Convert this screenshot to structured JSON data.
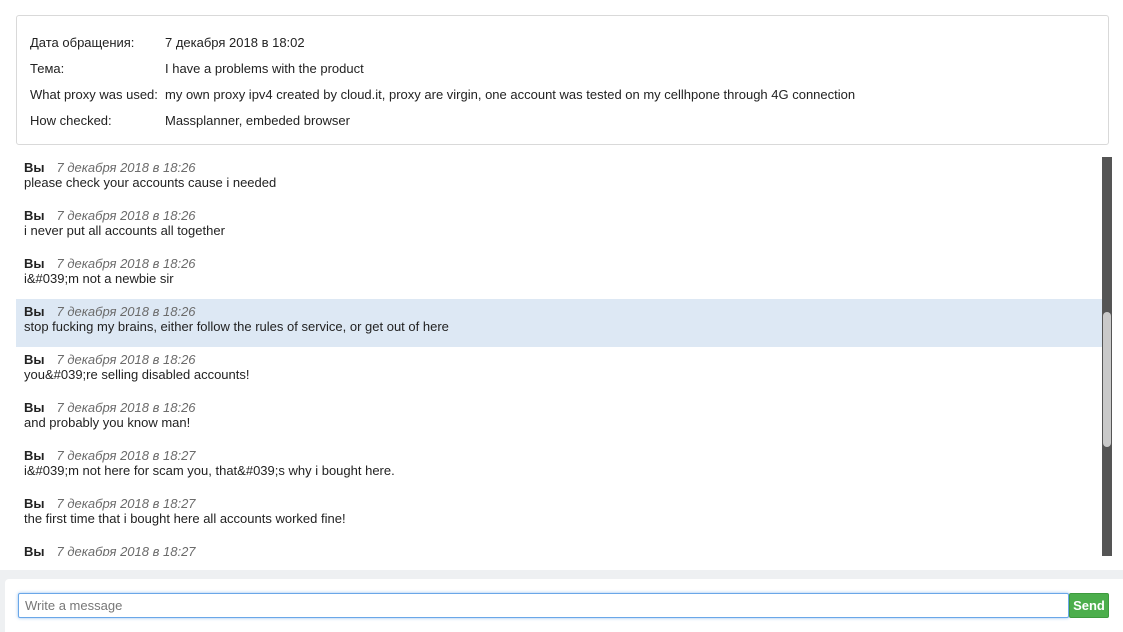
{
  "ticket": {
    "rows": [
      {
        "label": "Дата обращения:",
        "value": "7 декабря 2018 в 18:02"
      },
      {
        "label": "Тема:",
        "value": "I have a problems with the product"
      },
      {
        "label": "What proxy was used:",
        "value": "my own proxy ipv4 created by cloud.it, proxy are virgin, one account was tested on my cellhpone through 4G connection"
      },
      {
        "label": "How checked:",
        "value": "Massplanner, embeded browser"
      }
    ]
  },
  "messages": [
    {
      "author": "Вы",
      "time": "7 декабря 2018 в 18:26",
      "text": "please check your accounts cause i needed"
    },
    {
      "author": "Вы",
      "time": "7 декабря 2018 в 18:26",
      "text": "i never put all accounts all together"
    },
    {
      "author": "Вы",
      "time": "7 декабря 2018 в 18:26",
      "text": "i&#039;m not a newbie sir"
    },
    {
      "author": "Вы",
      "time": "7 декабря 2018 в 18:26",
      "text": "stop fucking my brains, either follow the rules of service, or get out of here"
    },
    {
      "author": "Вы",
      "time": "7 декабря 2018 в 18:26",
      "text": "you&#039;re selling disabled accounts!"
    },
    {
      "author": "Вы",
      "time": "7 декабря 2018 в 18:26",
      "text": "and probably you know man!"
    },
    {
      "author": "Вы",
      "time": "7 декабря 2018 в 18:27",
      "text": "i&#039;m not here for scam you, that&#039;s why i bought here."
    },
    {
      "author": "Вы",
      "time": "7 декабря 2018 в 18:27",
      "text": "the first time that i bought here all accounts worked fine!"
    },
    {
      "author": "Вы",
      "time": "7 декабря 2018 в 18:27",
      "text": ""
    }
  ],
  "composer": {
    "placeholder": "Write a message",
    "value": "",
    "send_label": "Send"
  },
  "colors": {
    "highlight": "#dde8f4",
    "send": "#4cae4c",
    "focus": "#6aa7e8"
  }
}
